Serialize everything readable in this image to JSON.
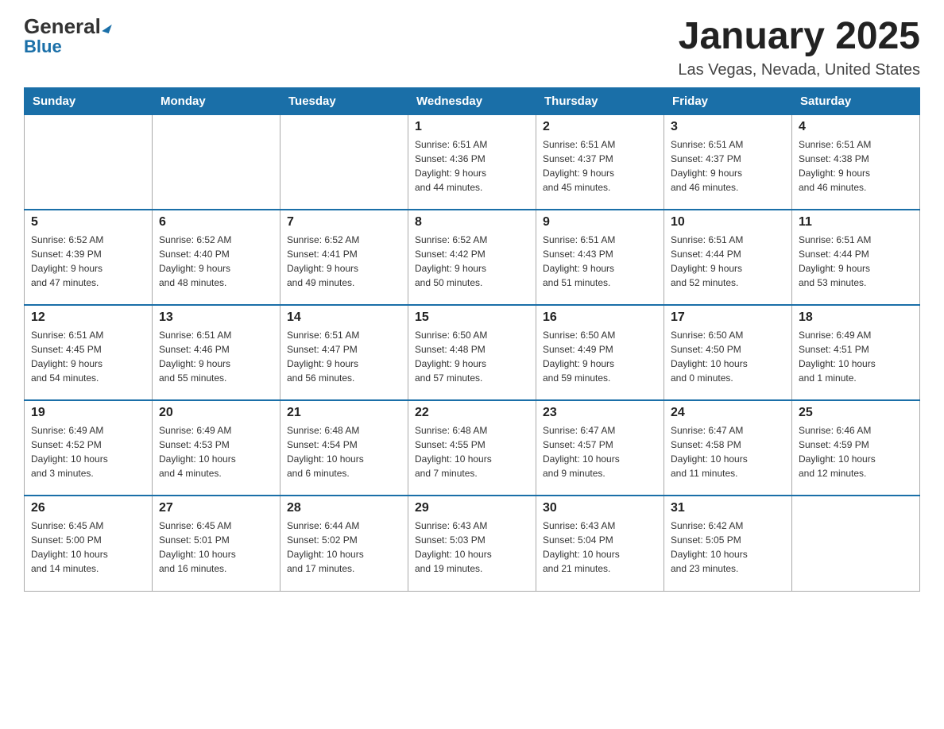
{
  "logo": {
    "general": "General",
    "blue": "Blue",
    "triangle": "▲"
  },
  "title": "January 2025",
  "subtitle": "Las Vegas, Nevada, United States",
  "weekdays": [
    "Sunday",
    "Monday",
    "Tuesday",
    "Wednesday",
    "Thursday",
    "Friday",
    "Saturday"
  ],
  "weeks": [
    [
      {
        "day": "",
        "info": ""
      },
      {
        "day": "",
        "info": ""
      },
      {
        "day": "",
        "info": ""
      },
      {
        "day": "1",
        "info": "Sunrise: 6:51 AM\nSunset: 4:36 PM\nDaylight: 9 hours\nand 44 minutes."
      },
      {
        "day": "2",
        "info": "Sunrise: 6:51 AM\nSunset: 4:37 PM\nDaylight: 9 hours\nand 45 minutes."
      },
      {
        "day": "3",
        "info": "Sunrise: 6:51 AM\nSunset: 4:37 PM\nDaylight: 9 hours\nand 46 minutes."
      },
      {
        "day": "4",
        "info": "Sunrise: 6:51 AM\nSunset: 4:38 PM\nDaylight: 9 hours\nand 46 minutes."
      }
    ],
    [
      {
        "day": "5",
        "info": "Sunrise: 6:52 AM\nSunset: 4:39 PM\nDaylight: 9 hours\nand 47 minutes."
      },
      {
        "day": "6",
        "info": "Sunrise: 6:52 AM\nSunset: 4:40 PM\nDaylight: 9 hours\nand 48 minutes."
      },
      {
        "day": "7",
        "info": "Sunrise: 6:52 AM\nSunset: 4:41 PM\nDaylight: 9 hours\nand 49 minutes."
      },
      {
        "day": "8",
        "info": "Sunrise: 6:52 AM\nSunset: 4:42 PM\nDaylight: 9 hours\nand 50 minutes."
      },
      {
        "day": "9",
        "info": "Sunrise: 6:51 AM\nSunset: 4:43 PM\nDaylight: 9 hours\nand 51 minutes."
      },
      {
        "day": "10",
        "info": "Sunrise: 6:51 AM\nSunset: 4:44 PM\nDaylight: 9 hours\nand 52 minutes."
      },
      {
        "day": "11",
        "info": "Sunrise: 6:51 AM\nSunset: 4:44 PM\nDaylight: 9 hours\nand 53 minutes."
      }
    ],
    [
      {
        "day": "12",
        "info": "Sunrise: 6:51 AM\nSunset: 4:45 PM\nDaylight: 9 hours\nand 54 minutes."
      },
      {
        "day": "13",
        "info": "Sunrise: 6:51 AM\nSunset: 4:46 PM\nDaylight: 9 hours\nand 55 minutes."
      },
      {
        "day": "14",
        "info": "Sunrise: 6:51 AM\nSunset: 4:47 PM\nDaylight: 9 hours\nand 56 minutes."
      },
      {
        "day": "15",
        "info": "Sunrise: 6:50 AM\nSunset: 4:48 PM\nDaylight: 9 hours\nand 57 minutes."
      },
      {
        "day": "16",
        "info": "Sunrise: 6:50 AM\nSunset: 4:49 PM\nDaylight: 9 hours\nand 59 minutes."
      },
      {
        "day": "17",
        "info": "Sunrise: 6:50 AM\nSunset: 4:50 PM\nDaylight: 10 hours\nand 0 minutes."
      },
      {
        "day": "18",
        "info": "Sunrise: 6:49 AM\nSunset: 4:51 PM\nDaylight: 10 hours\nand 1 minute."
      }
    ],
    [
      {
        "day": "19",
        "info": "Sunrise: 6:49 AM\nSunset: 4:52 PM\nDaylight: 10 hours\nand 3 minutes."
      },
      {
        "day": "20",
        "info": "Sunrise: 6:49 AM\nSunset: 4:53 PM\nDaylight: 10 hours\nand 4 minutes."
      },
      {
        "day": "21",
        "info": "Sunrise: 6:48 AM\nSunset: 4:54 PM\nDaylight: 10 hours\nand 6 minutes."
      },
      {
        "day": "22",
        "info": "Sunrise: 6:48 AM\nSunset: 4:55 PM\nDaylight: 10 hours\nand 7 minutes."
      },
      {
        "day": "23",
        "info": "Sunrise: 6:47 AM\nSunset: 4:57 PM\nDaylight: 10 hours\nand 9 minutes."
      },
      {
        "day": "24",
        "info": "Sunrise: 6:47 AM\nSunset: 4:58 PM\nDaylight: 10 hours\nand 11 minutes."
      },
      {
        "day": "25",
        "info": "Sunrise: 6:46 AM\nSunset: 4:59 PM\nDaylight: 10 hours\nand 12 minutes."
      }
    ],
    [
      {
        "day": "26",
        "info": "Sunrise: 6:45 AM\nSunset: 5:00 PM\nDaylight: 10 hours\nand 14 minutes."
      },
      {
        "day": "27",
        "info": "Sunrise: 6:45 AM\nSunset: 5:01 PM\nDaylight: 10 hours\nand 16 minutes."
      },
      {
        "day": "28",
        "info": "Sunrise: 6:44 AM\nSunset: 5:02 PM\nDaylight: 10 hours\nand 17 minutes."
      },
      {
        "day": "29",
        "info": "Sunrise: 6:43 AM\nSunset: 5:03 PM\nDaylight: 10 hours\nand 19 minutes."
      },
      {
        "day": "30",
        "info": "Sunrise: 6:43 AM\nSunset: 5:04 PM\nDaylight: 10 hours\nand 21 minutes."
      },
      {
        "day": "31",
        "info": "Sunrise: 6:42 AM\nSunset: 5:05 PM\nDaylight: 10 hours\nand 23 minutes."
      },
      {
        "day": "",
        "info": ""
      }
    ]
  ]
}
